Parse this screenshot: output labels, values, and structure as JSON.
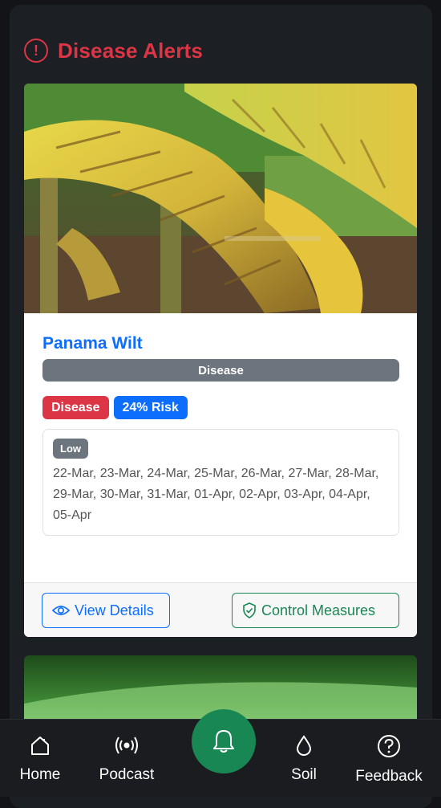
{
  "header": {
    "title": "Disease Alerts",
    "icon": "alert-circle-icon",
    "color": "#dc3545"
  },
  "alert_card": {
    "image": "banana-leaves-disease-photo",
    "disease_name": "Panama Wilt",
    "category": "Disease",
    "badges": {
      "type": "Disease",
      "risk": "24% Risk"
    },
    "risk_level": "Low",
    "dates": "22-Mar, 23-Mar, 24-Mar, 25-Mar, 26-Mar, 27-Mar, 28-Mar, 29-Mar, 30-Mar, 31-Mar, 01-Apr, 02-Apr, 03-Apr, 04-Apr, 05-Apr",
    "buttons": {
      "view_details": "View Details",
      "control_measures": "Control Measures"
    }
  },
  "bottom_nav": {
    "items": [
      {
        "label": "Home",
        "icon": "home-icon"
      },
      {
        "label": "Podcast",
        "icon": "podcast-icon"
      },
      {
        "label": "",
        "icon": "bell-icon"
      },
      {
        "label": "Soil",
        "icon": "droplet-icon"
      },
      {
        "label": "Feedback",
        "icon": "question-circle-icon"
      }
    ]
  },
  "colors": {
    "primary": "#0d6efd",
    "success": "#198754",
    "danger": "#dc3545",
    "secondary": "#6c757d",
    "background": "#1c1f24"
  }
}
